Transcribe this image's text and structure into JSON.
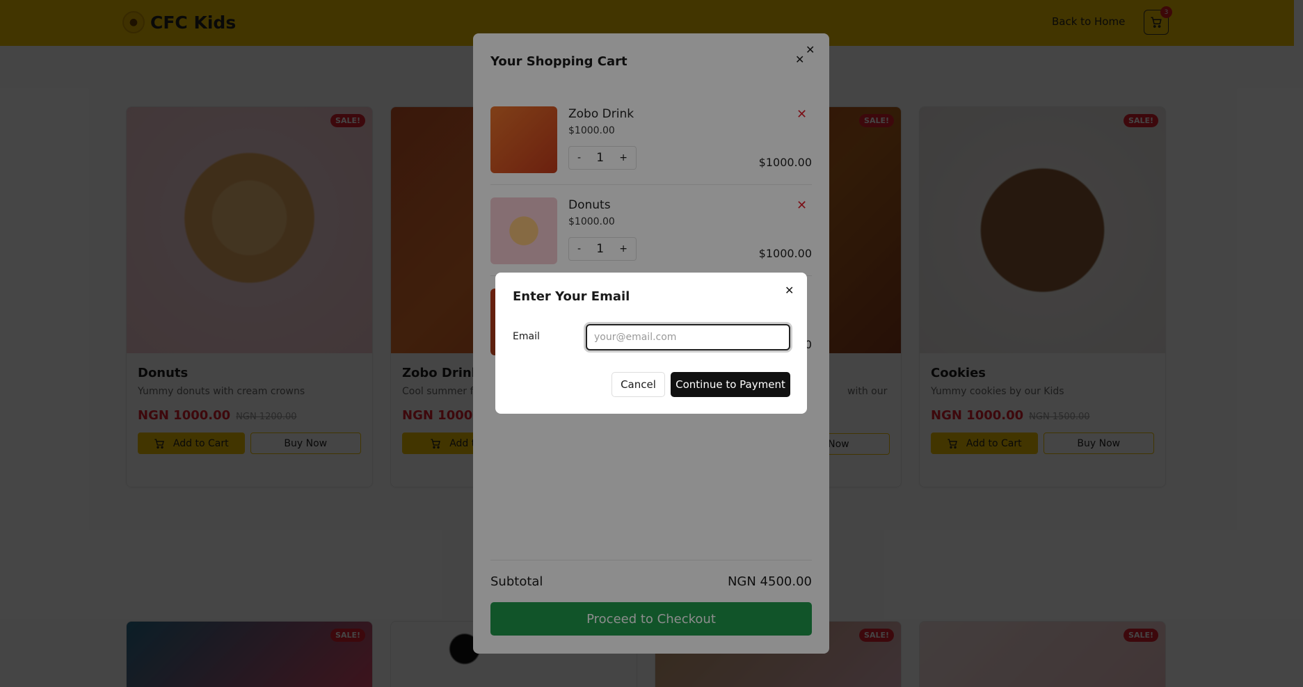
{
  "header": {
    "brand": "CFC Kids",
    "nav_home": "Back to Home",
    "cart_count": "3"
  },
  "products": [
    {
      "name": "Donuts",
      "description": "Yummy donuts with cream crowns",
      "price": "NGN 1000.00",
      "old_price": "NGN 1200.00",
      "badge": "SALE!",
      "add_label": "Add to Cart",
      "buy_label": "Buy Now"
    },
    {
      "name": "Zobo Drink",
      "description": "Cool summer fr",
      "price": "NGN 1000.",
      "badge": "",
      "add_label": "Add to",
      "buy_label": ""
    },
    {
      "name": "",
      "description": "with our",
      "price": "",
      "badge": "SALE!",
      "add_label": "",
      "buy_label": "y Now"
    },
    {
      "name": "Cookies",
      "description": "Yummy cookies by our Kids",
      "price": "NGN 1000.00",
      "old_price": "NGN 1500.00",
      "badge": "SALE!",
      "add_label": "Add to Cart",
      "buy_label": "Buy Now"
    }
  ],
  "bottom_row_badges": [
    "SALE!",
    "",
    "SALE!",
    "SALE!"
  ],
  "cart": {
    "title": "Your Shopping Cart",
    "items": [
      {
        "name": "Zobo Drink",
        "unit_price": "$1000.00",
        "qty": "1",
        "total": "$1000.00",
        "minus": "-",
        "plus": "+"
      },
      {
        "name": "Donuts",
        "unit_price": "$1000.00",
        "qty": "1",
        "total": "$1000.00",
        "minus": "-",
        "plus": "+"
      },
      {
        "total_partial": "0"
      }
    ],
    "subtotal_label": "Subtotal",
    "subtotal_value": "NGN 4500.00",
    "checkout_label": "Proceed to Checkout"
  },
  "email_modal": {
    "title": "Enter Your Email",
    "email_label": "Email",
    "email_placeholder": "your@email.com",
    "email_value": "",
    "cancel_label": "Cancel",
    "continue_label": "Continue to Payment"
  },
  "colors": {
    "brand_yellow": "#f2c200",
    "sale_red": "#e0202d",
    "checkout_green": "#1f9a4b",
    "continue_black": "#111111"
  }
}
